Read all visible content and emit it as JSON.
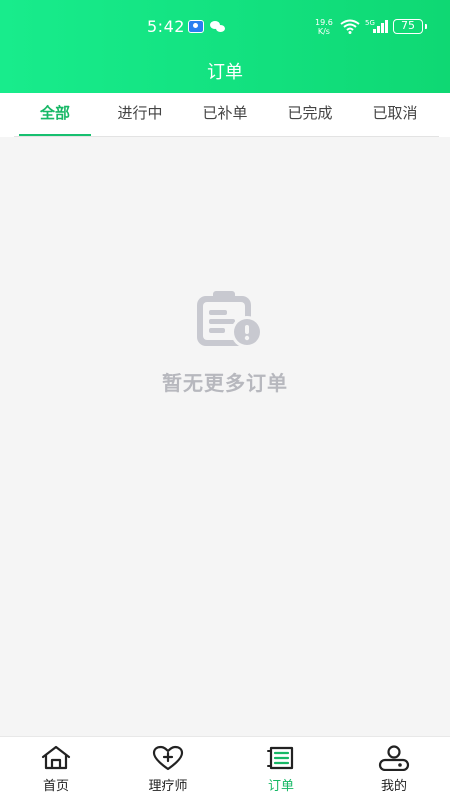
{
  "status_bar": {
    "time": "5:42",
    "speed_value": "19.6",
    "speed_unit": "K/s",
    "network": "5G",
    "battery": "75"
  },
  "header": {
    "title": "订单"
  },
  "tabs": [
    {
      "label": "全部",
      "active": true
    },
    {
      "label": "进行中",
      "active": false
    },
    {
      "label": "已补单",
      "active": false
    },
    {
      "label": "已完成",
      "active": false
    },
    {
      "label": "已取消",
      "active": false
    }
  ],
  "empty_state": {
    "message": "暂无更多订单",
    "icon": "clipboard-icon"
  },
  "bottom_nav": [
    {
      "label": "首页",
      "icon": "home-icon",
      "active": false
    },
    {
      "label": "理疗师",
      "icon": "heart-plus-icon",
      "active": false
    },
    {
      "label": "订单",
      "icon": "order-list-icon",
      "active": true
    },
    {
      "label": "我的",
      "icon": "profile-icon",
      "active": false
    }
  ],
  "colors": {
    "accent": "#17b866",
    "header_start": "#18ec8c",
    "header_end": "#0fd873",
    "background": "#f5f5f5",
    "empty_text": "#b7b8be"
  }
}
